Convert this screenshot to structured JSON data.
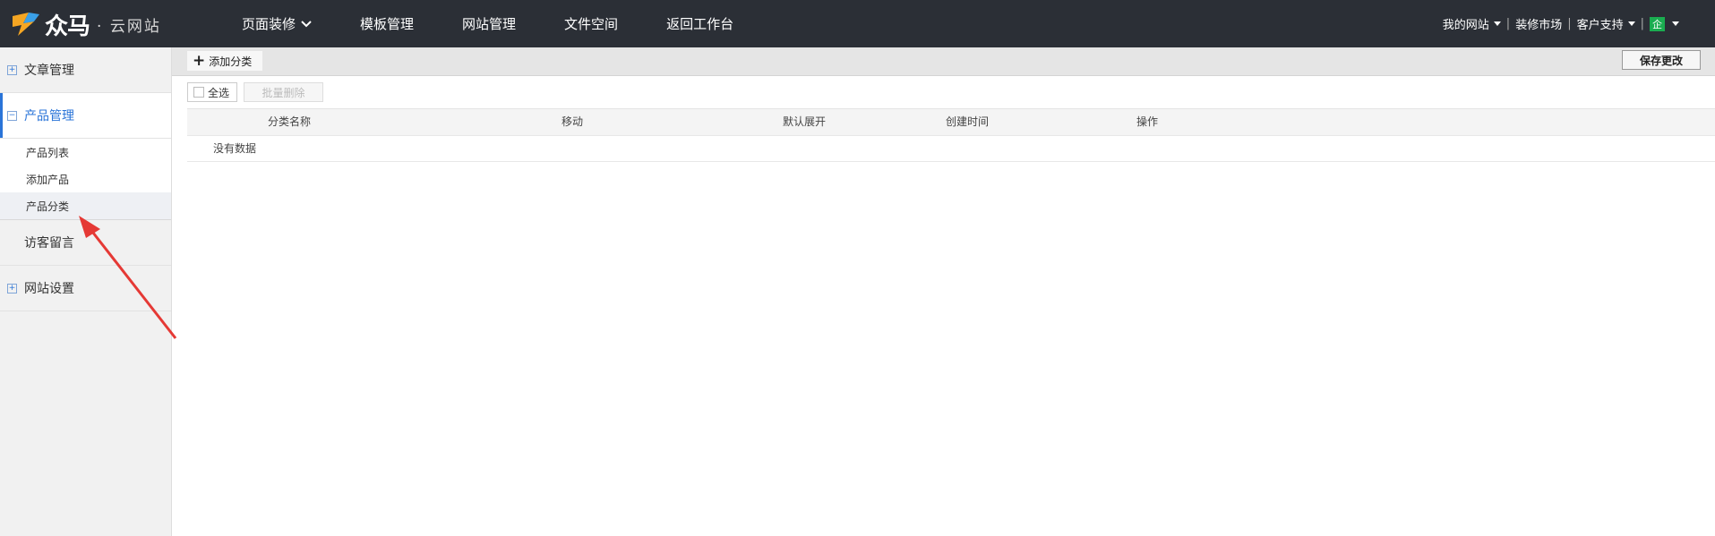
{
  "brand": {
    "name": "众马",
    "subtitle": "· 云网站"
  },
  "nav": [
    {
      "label": "页面装修",
      "has_dropdown": true
    },
    {
      "label": "模板管理"
    },
    {
      "label": "网站管理"
    },
    {
      "label": "文件空间"
    },
    {
      "label": "返回工作台"
    }
  ],
  "top_right": {
    "my_site": "我的网站",
    "decor_market": "装修市场",
    "support": "客户支持",
    "enterprise_badge": "企"
  },
  "sidebar": {
    "groups": [
      {
        "label": "文章管理",
        "icon": "plus-box-icon",
        "state": "collapsed"
      },
      {
        "label": "产品管理",
        "icon": "minus-box-icon",
        "state": "expanded"
      },
      {
        "label": "访客留言",
        "icon": "none"
      },
      {
        "label": "网站设置",
        "icon": "plus-box-icon",
        "state": "collapsed"
      }
    ],
    "product_sub_items": [
      "产品列表",
      "添加产品",
      "产品分类"
    ],
    "current_sub_item": "产品分类"
  },
  "toolbar": {
    "add_category": "添加分类",
    "save_changes": "保存更改",
    "select_all": "全选",
    "batch_delete": "批量删除"
  },
  "table": {
    "columns": [
      "分类名称",
      "移动",
      "默认展开",
      "创建时间",
      "操作"
    ],
    "empty_text": "没有数据"
  },
  "colors": {
    "topbar_bg": "#2b2f36",
    "accent": "#2a74d8",
    "arrow": "#e53935",
    "enterprise_green": "#1aad50"
  }
}
